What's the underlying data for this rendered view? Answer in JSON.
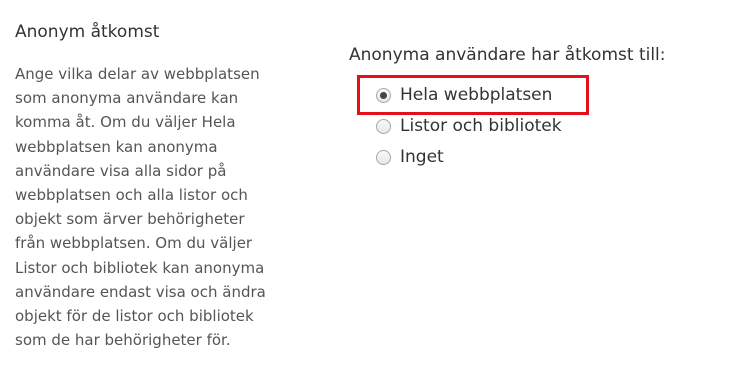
{
  "section": {
    "title": "Anonym åtkomst",
    "description_lines": [
      "Ange vilka delar av webbplatsen",
      "som anonyma användare kan",
      "komma åt. Om du väljer Hela",
      "webbplatsen kan anonyma",
      "användare visa alla sidor på",
      "webbplatsen och alla listor och",
      "objekt som ärver behörigheter",
      "från webbplatsen. Om du väljer",
      "Listor och bibliotek kan anonyma",
      "användare endast visa och ändra",
      "objekt för de listor och bibliotek",
      "som de har behörigheter för."
    ]
  },
  "access": {
    "heading": "Anonyma användare har åtkomst till:",
    "options": [
      {
        "label": "Hela webbplatsen",
        "selected": true
      },
      {
        "label": "Listor och bibliotek",
        "selected": false
      },
      {
        "label": "Inget",
        "selected": false
      }
    ]
  },
  "colors": {
    "highlight_border": "#e3101b",
    "text_primary": "#333333",
    "text_secondary": "#555555"
  }
}
